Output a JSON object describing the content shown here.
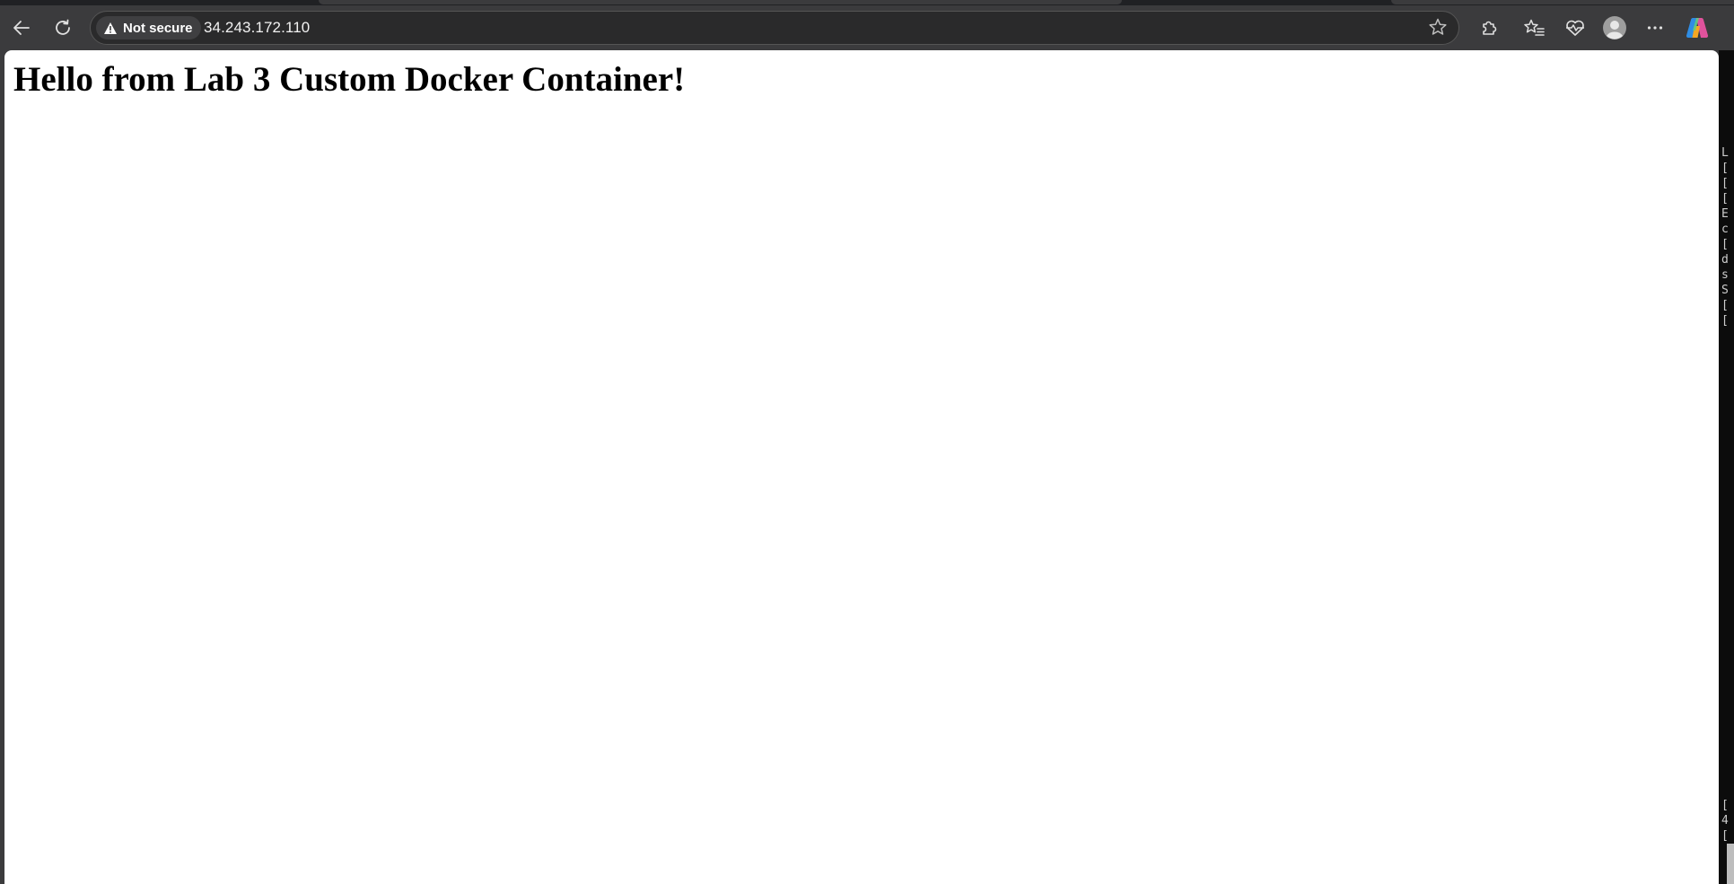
{
  "browser": {
    "security_label": "Not secure",
    "url": "34.243.172.110",
    "icons": {
      "back": "back-arrow-icon",
      "reload": "reload-icon",
      "warning": "warning-triangle-icon",
      "favorite": "star-icon",
      "extensions": "puzzle-icon",
      "favorites_list": "favorites-list-icon",
      "browser_essentials": "heart-pulse-icon",
      "profile": "avatar-icon",
      "menu": "more-dots-icon",
      "copilot": "copilot-icon"
    }
  },
  "page": {
    "heading": "Hello from Lab 3 Custom Docker Container!"
  },
  "terminal_fragment": {
    "top_lines": [
      "L",
      "[",
      "[",
      "[",
      "E",
      "c",
      "[",
      "d",
      "s",
      "S",
      "[",
      "["
    ],
    "bottom_lines": [
      "[",
      "4",
      "["
    ]
  },
  "colors": {
    "chrome_bg": "#3b3b3d",
    "address_bg": "#2a2a2b",
    "page_bg": "#ffffff",
    "text": "#000000",
    "terminal_bg": "#0c0c0c"
  }
}
